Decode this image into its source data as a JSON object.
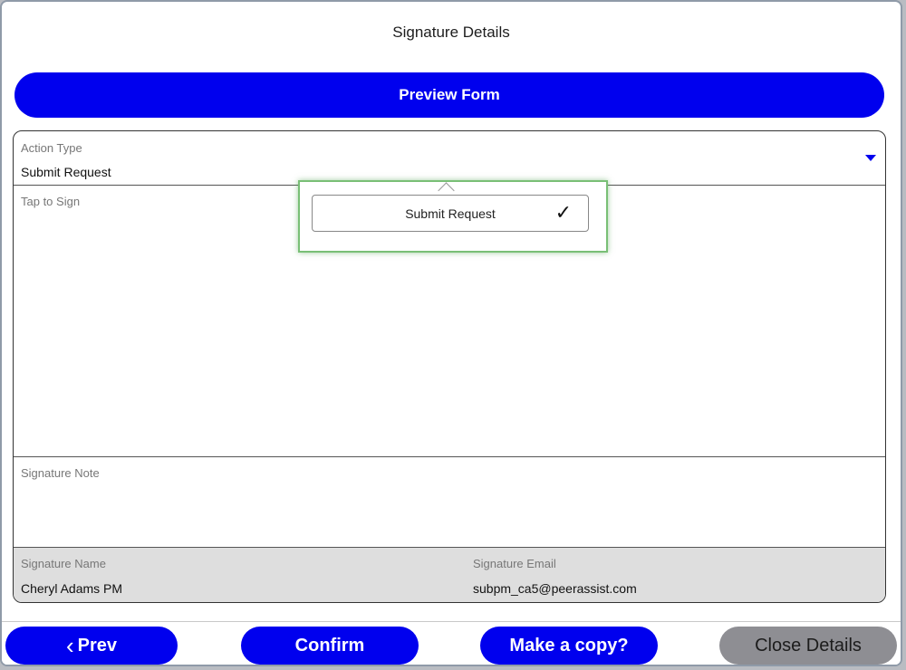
{
  "title": "Signature Details",
  "preview_button": "Preview Form",
  "form": {
    "action_type_label": "Action Type",
    "action_type_value": "Submit Request",
    "tap_to_sign_label": "Tap to Sign",
    "signature_note_label": "Signature Note",
    "signature_name_label": "Signature Name",
    "signature_name_value": "Cheryl Adams PM",
    "signature_email_label": "Signature Email",
    "signature_email_value": "subpm_ca5@peerassist.com"
  },
  "dropdown": {
    "options": [
      "Submit Request"
    ],
    "selected": "Submit Request",
    "check_glyph": "✓"
  },
  "footer": {
    "prev_glyph": "‹",
    "prev_label": "Prev",
    "confirm_label": "Confirm",
    "copy_label": "Make a copy?",
    "close_label": "Close Details"
  },
  "colors": {
    "accent": "#0000ee",
    "disabled_button": "#8e8e93",
    "highlight_border": "#79bf76",
    "readonly_background": "#dedede"
  },
  "icons": {
    "caret": "chevron-down-icon",
    "check": "check-icon",
    "prev": "chevron-left-icon"
  }
}
